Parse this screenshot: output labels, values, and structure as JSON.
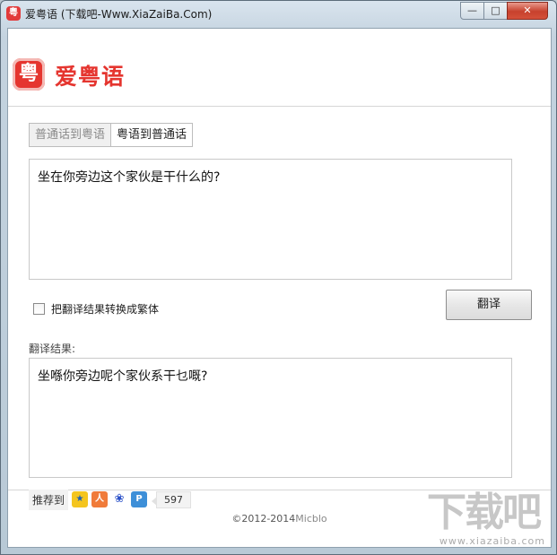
{
  "window": {
    "title": "爱粤语 (下载吧-Www.XiaZaiBa.Com)",
    "controls": {
      "minimize": "—",
      "maximize": "□",
      "close": "✕"
    }
  },
  "logo": {
    "mark": "粤",
    "text": "爱粤语"
  },
  "tabs": [
    {
      "label": "普通话到粤语",
      "active": true
    },
    {
      "label": "粤语到普通话",
      "active": false
    }
  ],
  "input": {
    "value": "坐在你旁边这个家伙是干什么的?"
  },
  "option": {
    "traditional_label": "把翻译结果转换成繁体",
    "checked": false
  },
  "translate_button": "翻译",
  "result": {
    "label": "翻译结果:",
    "value": "坐喺你旁边呢个家伙系干乜嘅?"
  },
  "share": {
    "label": "推荐到",
    "icons": [
      "qzone-icon",
      "renren-icon",
      "baidu-icon",
      "pengyou-icon"
    ],
    "count": "597"
  },
  "footer": {
    "copyright": "©2012-2014",
    "brand": "Micblo"
  },
  "watermark": {
    "text": "下载吧",
    "url": "www.xiazaiba.com"
  }
}
